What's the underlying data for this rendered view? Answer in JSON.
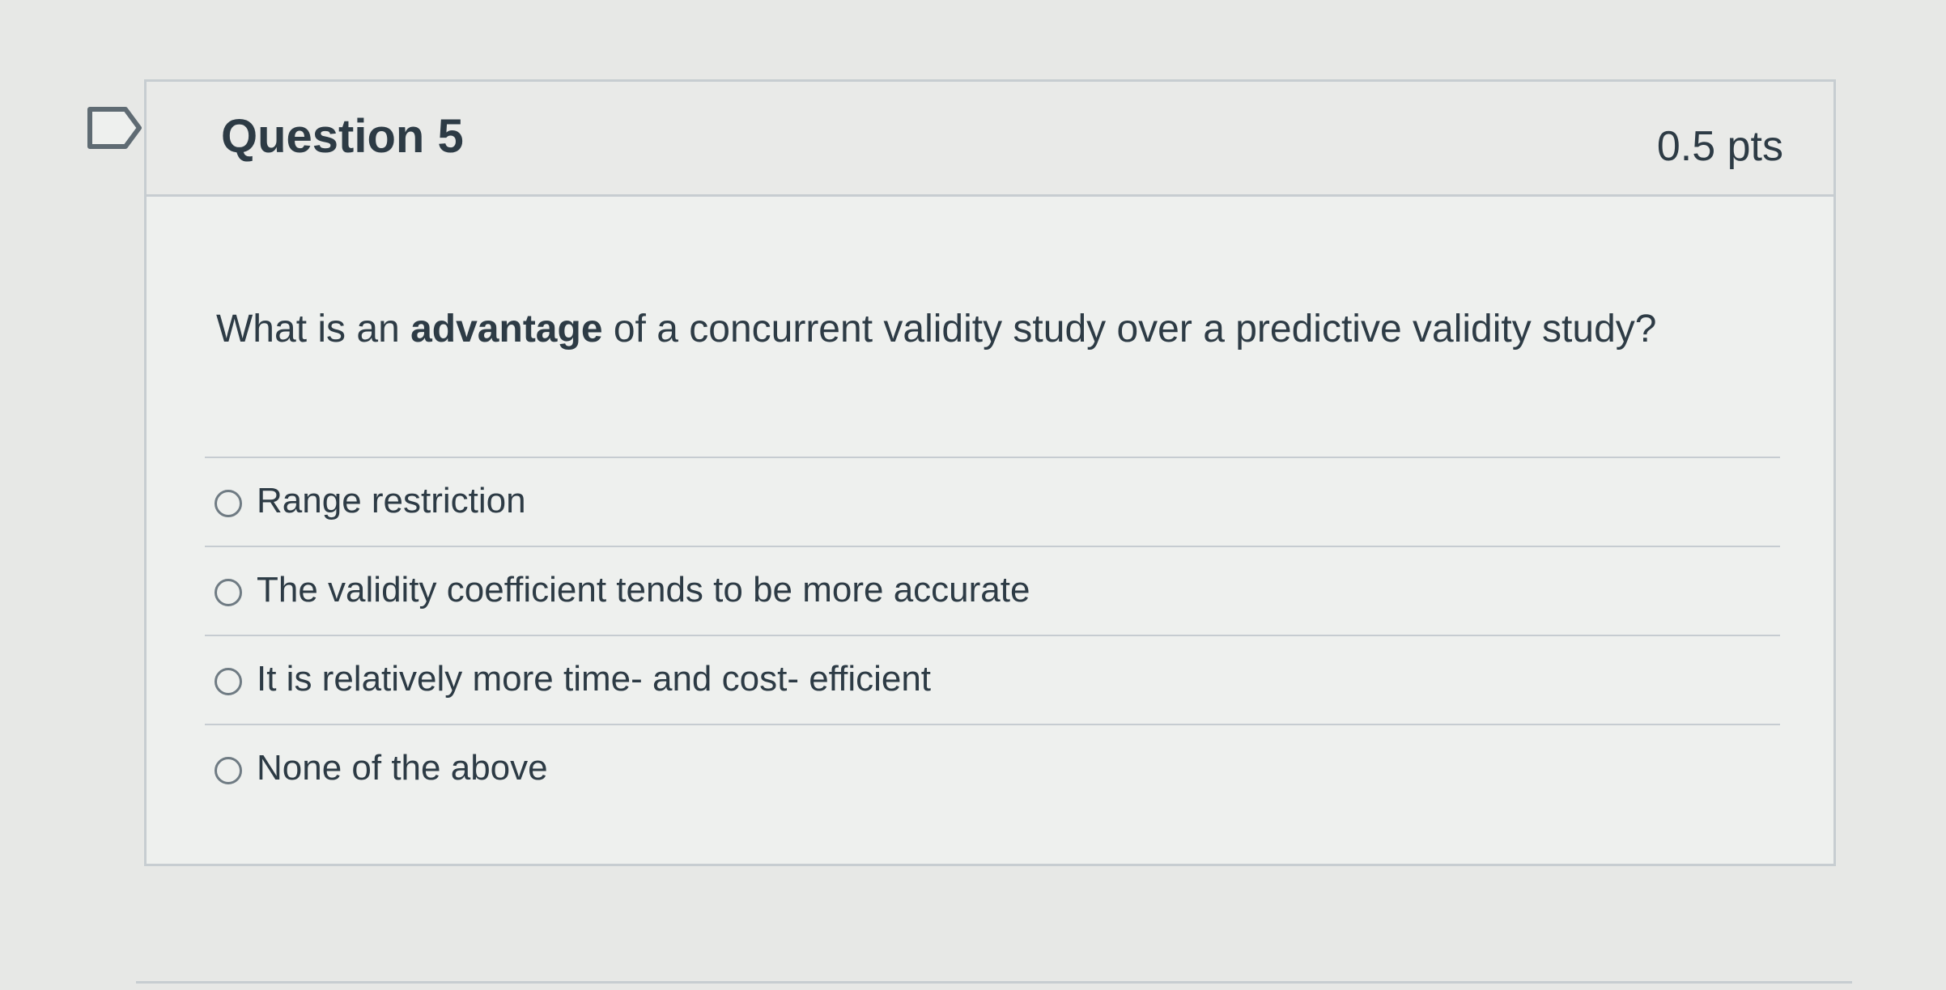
{
  "question": {
    "title": "Question 5",
    "points": "0.5 pts",
    "prompt_before": "What is an ",
    "prompt_bold": "advantage",
    "prompt_after": " of a concurrent validity study over a predictive validity study?",
    "flag_icon": "flag-outline-icon",
    "answers": [
      {
        "label": "Range restriction",
        "selected": false,
        "icon": "radio-unchecked-icon"
      },
      {
        "label": "The validity coefficient tends to be more accurate",
        "selected": false,
        "icon": "radio-unchecked-icon"
      },
      {
        "label": "It is relatively more time- and cost- efficient",
        "selected": false,
        "icon": "radio-unchecked-icon"
      },
      {
        "label": "None of the above",
        "selected": false,
        "icon": "radio-unchecked-icon"
      }
    ]
  },
  "colors": {
    "page_background": "#e7e8e6",
    "card_border": "#c7cdd1",
    "text": "#2d3b45",
    "radio_border": "#6f7b83"
  }
}
